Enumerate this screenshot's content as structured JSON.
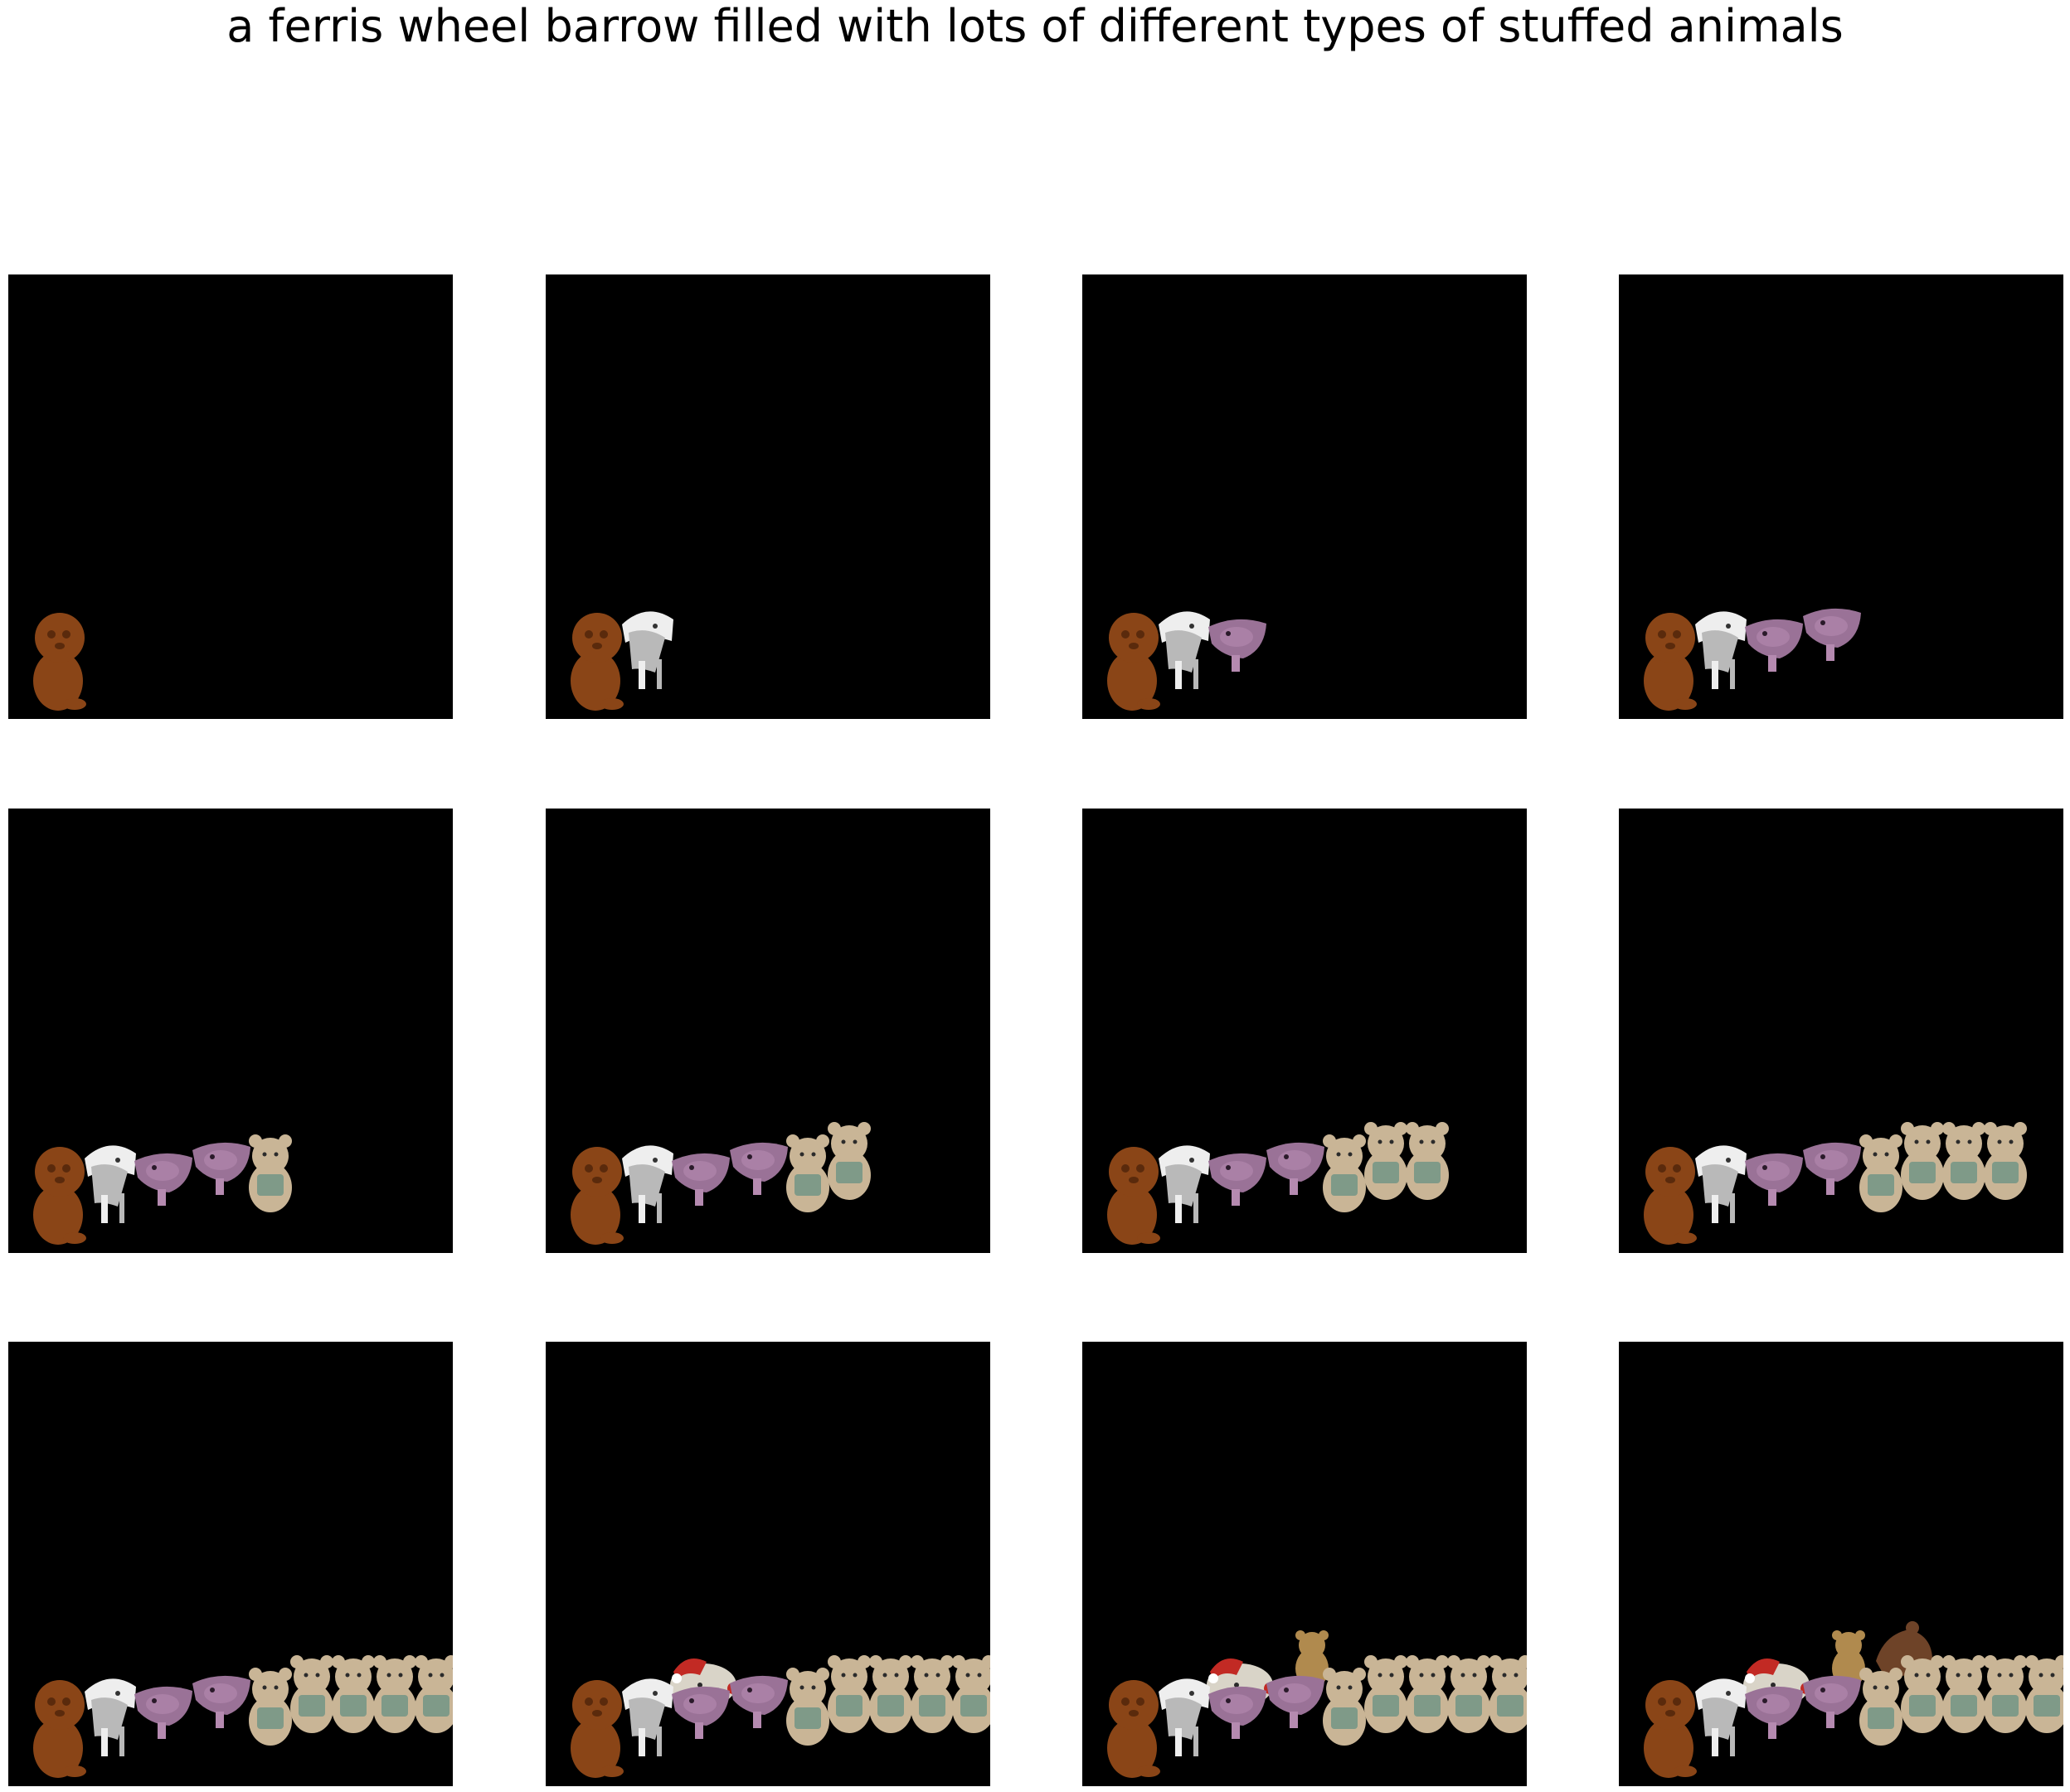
{
  "figure": {
    "title": "a ferris wheel barrow filled with lots of different types of stuffed animals"
  },
  "panel_background": "#000000",
  "steps": [
    {
      "step": 1,
      "objects": [
        "brown-poodle-plush"
      ]
    },
    {
      "step": 2,
      "objects": [
        "brown-poodle-plush",
        "white-bunny-plush"
      ]
    },
    {
      "step": 3,
      "objects": [
        "brown-poodle-plush",
        "white-bunny-plush",
        "pink-pig-plush"
      ]
    },
    {
      "step": 4,
      "objects": [
        "brown-poodle-plush",
        "white-bunny-plush",
        "pink-pig-plush",
        "pink-pig-plush"
      ]
    },
    {
      "step": 5,
      "objects": [
        "brown-poodle-plush",
        "white-bunny-plush",
        "pink-pig-plush",
        "pink-pig-plush",
        "tan-bear-plush"
      ]
    },
    {
      "step": 6,
      "objects": [
        "brown-poodle-plush",
        "white-bunny-plush",
        "pink-pig-plush",
        "pink-pig-plush",
        "tan-bear-plush",
        "tan-bear-plush"
      ]
    },
    {
      "step": 7,
      "objects": [
        "brown-poodle-plush",
        "white-bunny-plush",
        "pink-pig-plush",
        "pink-pig-plush",
        "tan-bear-plush",
        "tan-bear-plush",
        "tan-bear-plush"
      ]
    },
    {
      "step": 8,
      "objects": [
        "brown-poodle-plush",
        "white-bunny-plush",
        "pink-pig-plush",
        "pink-pig-plush",
        "tan-bear-plush",
        "tan-bear-plush",
        "tan-bear-plush",
        "tan-bear-plush"
      ]
    },
    {
      "step": 9,
      "objects": [
        "brown-poodle-plush",
        "white-bunny-plush",
        "pink-pig-plush",
        "pink-pig-plush",
        "tan-bear-plush",
        "tan-bear-plush",
        "tan-bear-plush",
        "tan-bear-plush",
        "tan-bear-plush"
      ]
    },
    {
      "step": 10,
      "objects": [
        "brown-poodle-plush",
        "white-bunny-plush",
        "pink-pig-plush",
        "pink-pig-plush",
        "tan-bear-plush",
        "tan-bear-plush",
        "tan-bear-plush",
        "tan-bear-plush",
        "tan-bear-plush",
        "santa-sheep-plush"
      ]
    },
    {
      "step": 11,
      "objects": [
        "brown-poodle-plush",
        "white-bunny-plush",
        "pink-pig-plush",
        "pink-pig-plush",
        "tan-bear-plush",
        "tan-bear-plush",
        "tan-bear-plush",
        "tan-bear-plush",
        "tan-bear-plush",
        "santa-sheep-plush",
        "golden-bear-plush"
      ]
    },
    {
      "step": 12,
      "objects": [
        "brown-poodle-plush",
        "white-bunny-plush",
        "pink-pig-plush",
        "pink-pig-plush",
        "tan-bear-plush",
        "tan-bear-plush",
        "tan-bear-plush",
        "tan-bear-plush",
        "tan-bear-plush",
        "santa-sheep-plush",
        "golden-bear-plush",
        "brown-bear-plush"
      ]
    }
  ],
  "colors": {
    "poodle": "#8a4517",
    "poodle_dark": "#5a2a0c",
    "bunny": "#eeeeee",
    "bunny_shadow": "#b9b9b9",
    "pig": "#9a7297",
    "pig_light": "#b58ab0",
    "bear": "#c9b596",
    "bear_shirt": "#7f9a88",
    "santa_red": "#c22a24",
    "golden_bear": "#b08a4e",
    "brown_bear": "#6e4328"
  }
}
